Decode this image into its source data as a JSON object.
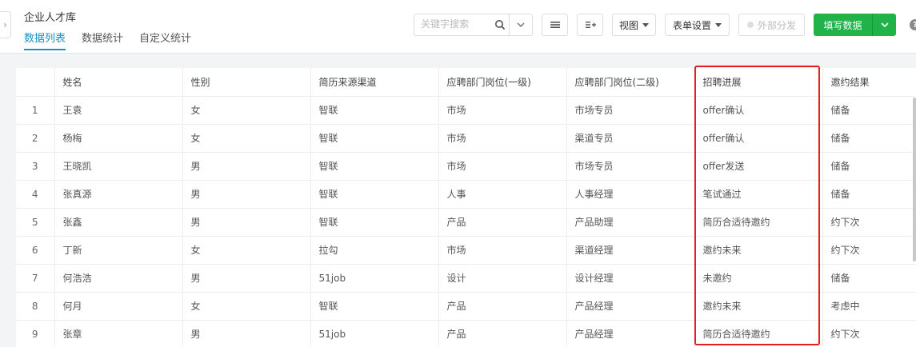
{
  "header": {
    "app_title": "企业人才库",
    "tabs": [
      {
        "label": "数据列表",
        "active": true
      },
      {
        "label": "数据统计",
        "active": false
      },
      {
        "label": "自定义统计",
        "active": false
      }
    ]
  },
  "toolbar": {
    "search_placeholder": "关键字搜索",
    "view_label": "视图",
    "form_settings_label": "表单设置",
    "external_share_label": "外部分发",
    "fill_data_label": "填写数据",
    "help_label": "?"
  },
  "table": {
    "columns": [
      "",
      "姓名",
      "性别",
      "简历来源渠道",
      "应聘部门岗位(一级)",
      "应聘部门岗位(二级)",
      "招聘进展",
      "邀约结果"
    ],
    "rows": [
      [
        "1",
        "王袁",
        "女",
        "智联",
        "市场",
        "市场专员",
        "offer确认",
        "储备"
      ],
      [
        "2",
        "杨梅",
        "女",
        "智联",
        "市场",
        "渠道专员",
        "offer确认",
        "储备"
      ],
      [
        "3",
        "王晓凯",
        "男",
        "智联",
        "市场",
        "市场专员",
        "offer发送",
        "储备"
      ],
      [
        "4",
        "张真源",
        "男",
        "智联",
        "人事",
        "人事经理",
        "笔试通过",
        "储备"
      ],
      [
        "5",
        "张鑫",
        "男",
        "智联",
        "产品",
        "产品助理",
        "简历合适待邀约",
        "约下次"
      ],
      [
        "6",
        "丁新",
        "女",
        "拉勾",
        "市场",
        "渠道经理",
        "邀约未来",
        "约下次"
      ],
      [
        "7",
        "何浩浩",
        "男",
        "51job",
        "设计",
        "设计经理",
        "未邀约",
        "储备"
      ],
      [
        "8",
        "何月",
        "女",
        "智联",
        "产品",
        "产品经理",
        "邀约未来",
        "考虑中"
      ],
      [
        "9",
        "张章",
        "男",
        "51job",
        "产品",
        "产品经理",
        "简历合适待邀约",
        "约下次"
      ]
    ]
  },
  "colors": {
    "accent": "#1890c8",
    "primary_button": "#1fb34a",
    "highlight_border": "#e41e1e"
  }
}
